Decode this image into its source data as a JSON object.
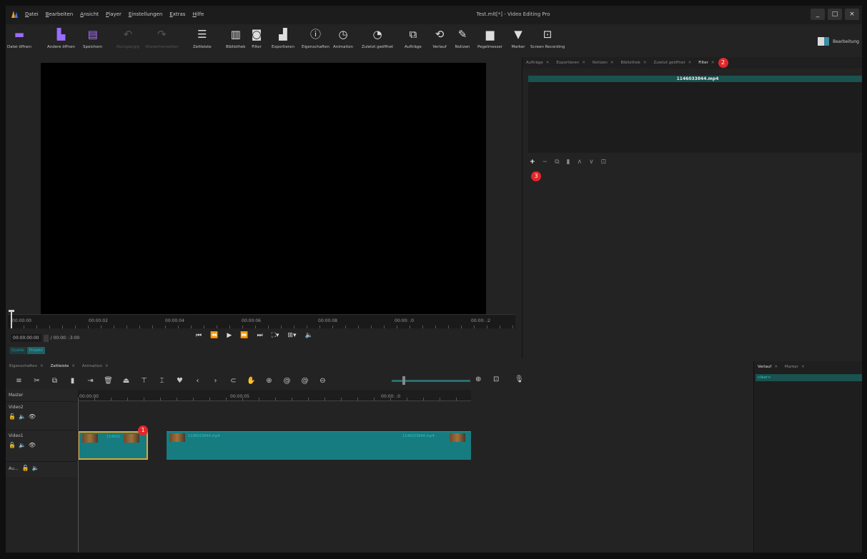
{
  "window": {
    "title": "Test.mlt[*] - Video Editing Pro",
    "controls": [
      "_",
      "□",
      "×"
    ]
  },
  "menu": [
    "Datei",
    "Bearbeiten",
    "Ansicht",
    "Player",
    "Einstellungen",
    "Extras",
    "Hilfe"
  ],
  "toolbar": [
    {
      "label": "Datei öffnen",
      "icon": "folder-icon",
      "glyph": "▬",
      "color": "#9a6cff"
    },
    {
      "label": "Andere öffnen",
      "icon": "open-other-icon",
      "glyph": "▙",
      "color": "#9a6cff"
    },
    {
      "label": "Speichern",
      "icon": "save-icon",
      "glyph": "▤",
      "color": "#b070ff"
    },
    {
      "label": "Rückgängig",
      "icon": "undo-icon",
      "glyph": "↶",
      "color": "#ddd",
      "disabled": true
    },
    {
      "label": "Wiederherstellen",
      "icon": "redo-icon",
      "glyph": "↷",
      "color": "#ddd",
      "disabled": true
    },
    {
      "label": "Zeitleiste",
      "icon": "timeline-icon",
      "glyph": "☰",
      "color": "#ddd"
    },
    {
      "label": "Bibliothek",
      "icon": "library-icon",
      "glyph": "▥",
      "color": "#ddd"
    },
    {
      "label": "Filter",
      "icon": "filter-icon",
      "glyph": "◙",
      "color": "#ddd"
    },
    {
      "label": "Exportieren",
      "icon": "export-icon",
      "glyph": "▟",
      "color": "#ddd"
    },
    {
      "label": "Eigenschaften",
      "icon": "properties-icon",
      "glyph": "ⓘ",
      "color": "#ddd"
    },
    {
      "label": "Animation",
      "icon": "animation-icon",
      "glyph": "◷",
      "color": "#ddd"
    },
    {
      "label": "Zuletzt geöffnet",
      "icon": "recent-icon",
      "glyph": "◔",
      "color": "#ddd"
    },
    {
      "label": "Aufträge",
      "icon": "jobs-icon",
      "glyph": "⧉",
      "color": "#ddd"
    },
    {
      "label": "Verlauf",
      "icon": "history-icon",
      "glyph": "⟲",
      "color": "#ddd"
    },
    {
      "label": "Notizen",
      "icon": "notes-icon",
      "glyph": "✎",
      "color": "#ddd"
    },
    {
      "label": "Pegelmesser",
      "icon": "meter-icon",
      "glyph": "▆",
      "color": "#ddd"
    },
    {
      "label": "Marker",
      "icon": "marker-icon",
      "glyph": "▼",
      "color": "#ddd"
    },
    {
      "label": "Screen Recording",
      "icon": "screen-recording-icon",
      "glyph": "⊡",
      "color": "#ddd"
    }
  ],
  "layout_button": {
    "label": "Bearbeitung"
  },
  "player": {
    "ruler_labels": [
      "00:00:00",
      "00:00:02",
      "00:00:04",
      "00:00:06",
      "00:00:08",
      "00:00: :0",
      "00:00: :2"
    ],
    "position": "00:00:00:00",
    "duration": "/ 00:00: :3:00",
    "source_tabs": [
      "Quelle",
      "Projekt"
    ]
  },
  "right_panel": {
    "tabs": [
      "Aufträge",
      "Exportieren",
      "Notizen",
      "Bibliothek",
      "Zuletzt geöffnet",
      "Filter"
    ],
    "active_tab": "Filter",
    "filter_clip": "1146033844.mp4",
    "badge2": "2",
    "badge3": "3"
  },
  "bottom": {
    "tabs": [
      "Eigenschaften",
      "Zeitleiste",
      "Animation"
    ],
    "active_tab": "Zeitleiste",
    "master": "Master",
    "ruler_labels": [
      "00:00:00",
      "00:00:05",
      "00:00: :0"
    ],
    "tracks": [
      "Video2",
      "Video1",
      "Au..."
    ],
    "clip_names": [
      "114602",
      "1146033844.mp4",
      "1146033844.mp4"
    ],
    "badge1": "1"
  },
  "history_panel": {
    "tabs": [
      "Verlauf",
      "Marker"
    ],
    "item": "<leer>"
  }
}
